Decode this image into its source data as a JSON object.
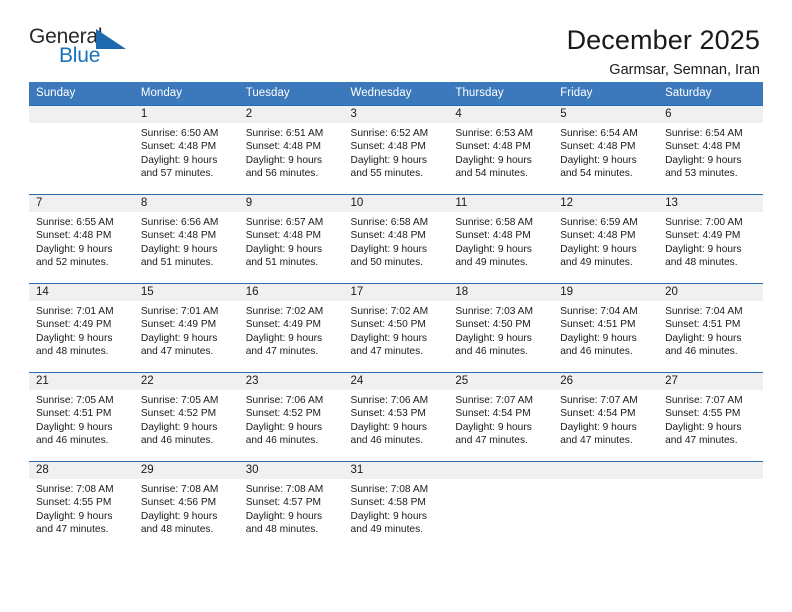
{
  "brand": {
    "name_top": "General",
    "name_bottom": "Blue",
    "color_blue": "#1a72ba",
    "color_dark": "#26292b",
    "triangle_icon": "blue-triangle-icon"
  },
  "header": {
    "title": "December 2025",
    "location": "Garmsar, Semnan, Iran"
  },
  "theme": {
    "header_bg": "#3c78bc",
    "header_text": "#ffffff",
    "daynum_band_bg": "#f0f0f0",
    "row_border": "#2c6ab0"
  },
  "weekdays": [
    "Sunday",
    "Monday",
    "Tuesday",
    "Wednesday",
    "Thursday",
    "Friday",
    "Saturday"
  ],
  "weeks": [
    [
      {
        "day": "",
        "sunrise": "",
        "sunset": "",
        "daylight_line1": "",
        "daylight_line2": "",
        "empty": true
      },
      {
        "day": "1",
        "sunrise": "Sunrise: 6:50 AM",
        "sunset": "Sunset: 4:48 PM",
        "daylight_line1": "Daylight: 9 hours",
        "daylight_line2": "and 57 minutes.",
        "empty": false
      },
      {
        "day": "2",
        "sunrise": "Sunrise: 6:51 AM",
        "sunset": "Sunset: 4:48 PM",
        "daylight_line1": "Daylight: 9 hours",
        "daylight_line2": "and 56 minutes.",
        "empty": false
      },
      {
        "day": "3",
        "sunrise": "Sunrise: 6:52 AM",
        "sunset": "Sunset: 4:48 PM",
        "daylight_line1": "Daylight: 9 hours",
        "daylight_line2": "and 55 minutes.",
        "empty": false
      },
      {
        "day": "4",
        "sunrise": "Sunrise: 6:53 AM",
        "sunset": "Sunset: 4:48 PM",
        "daylight_line1": "Daylight: 9 hours",
        "daylight_line2": "and 54 minutes.",
        "empty": false
      },
      {
        "day": "5",
        "sunrise": "Sunrise: 6:54 AM",
        "sunset": "Sunset: 4:48 PM",
        "daylight_line1": "Daylight: 9 hours",
        "daylight_line2": "and 54 minutes.",
        "empty": false
      },
      {
        "day": "6",
        "sunrise": "Sunrise: 6:54 AM",
        "sunset": "Sunset: 4:48 PM",
        "daylight_line1": "Daylight: 9 hours",
        "daylight_line2": "and 53 minutes.",
        "empty": false
      }
    ],
    [
      {
        "day": "7",
        "sunrise": "Sunrise: 6:55 AM",
        "sunset": "Sunset: 4:48 PM",
        "daylight_line1": "Daylight: 9 hours",
        "daylight_line2": "and 52 minutes.",
        "empty": false
      },
      {
        "day": "8",
        "sunrise": "Sunrise: 6:56 AM",
        "sunset": "Sunset: 4:48 PM",
        "daylight_line1": "Daylight: 9 hours",
        "daylight_line2": "and 51 minutes.",
        "empty": false
      },
      {
        "day": "9",
        "sunrise": "Sunrise: 6:57 AM",
        "sunset": "Sunset: 4:48 PM",
        "daylight_line1": "Daylight: 9 hours",
        "daylight_line2": "and 51 minutes.",
        "empty": false
      },
      {
        "day": "10",
        "sunrise": "Sunrise: 6:58 AM",
        "sunset": "Sunset: 4:48 PM",
        "daylight_line1": "Daylight: 9 hours",
        "daylight_line2": "and 50 minutes.",
        "empty": false
      },
      {
        "day": "11",
        "sunrise": "Sunrise: 6:58 AM",
        "sunset": "Sunset: 4:48 PM",
        "daylight_line1": "Daylight: 9 hours",
        "daylight_line2": "and 49 minutes.",
        "empty": false
      },
      {
        "day": "12",
        "sunrise": "Sunrise: 6:59 AM",
        "sunset": "Sunset: 4:48 PM",
        "daylight_line1": "Daylight: 9 hours",
        "daylight_line2": "and 49 minutes.",
        "empty": false
      },
      {
        "day": "13",
        "sunrise": "Sunrise: 7:00 AM",
        "sunset": "Sunset: 4:49 PM",
        "daylight_line1": "Daylight: 9 hours",
        "daylight_line2": "and 48 minutes.",
        "empty": false
      }
    ],
    [
      {
        "day": "14",
        "sunrise": "Sunrise: 7:01 AM",
        "sunset": "Sunset: 4:49 PM",
        "daylight_line1": "Daylight: 9 hours",
        "daylight_line2": "and 48 minutes.",
        "empty": false
      },
      {
        "day": "15",
        "sunrise": "Sunrise: 7:01 AM",
        "sunset": "Sunset: 4:49 PM",
        "daylight_line1": "Daylight: 9 hours",
        "daylight_line2": "and 47 minutes.",
        "empty": false
      },
      {
        "day": "16",
        "sunrise": "Sunrise: 7:02 AM",
        "sunset": "Sunset: 4:49 PM",
        "daylight_line1": "Daylight: 9 hours",
        "daylight_line2": "and 47 minutes.",
        "empty": false
      },
      {
        "day": "17",
        "sunrise": "Sunrise: 7:02 AM",
        "sunset": "Sunset: 4:50 PM",
        "daylight_line1": "Daylight: 9 hours",
        "daylight_line2": "and 47 minutes.",
        "empty": false
      },
      {
        "day": "18",
        "sunrise": "Sunrise: 7:03 AM",
        "sunset": "Sunset: 4:50 PM",
        "daylight_line1": "Daylight: 9 hours",
        "daylight_line2": "and 46 minutes.",
        "empty": false
      },
      {
        "day": "19",
        "sunrise": "Sunrise: 7:04 AM",
        "sunset": "Sunset: 4:51 PM",
        "daylight_line1": "Daylight: 9 hours",
        "daylight_line2": "and 46 minutes.",
        "empty": false
      },
      {
        "day": "20",
        "sunrise": "Sunrise: 7:04 AM",
        "sunset": "Sunset: 4:51 PM",
        "daylight_line1": "Daylight: 9 hours",
        "daylight_line2": "and 46 minutes.",
        "empty": false
      }
    ],
    [
      {
        "day": "21",
        "sunrise": "Sunrise: 7:05 AM",
        "sunset": "Sunset: 4:51 PM",
        "daylight_line1": "Daylight: 9 hours",
        "daylight_line2": "and 46 minutes.",
        "empty": false
      },
      {
        "day": "22",
        "sunrise": "Sunrise: 7:05 AM",
        "sunset": "Sunset: 4:52 PM",
        "daylight_line1": "Daylight: 9 hours",
        "daylight_line2": "and 46 minutes.",
        "empty": false
      },
      {
        "day": "23",
        "sunrise": "Sunrise: 7:06 AM",
        "sunset": "Sunset: 4:52 PM",
        "daylight_line1": "Daylight: 9 hours",
        "daylight_line2": "and 46 minutes.",
        "empty": false
      },
      {
        "day": "24",
        "sunrise": "Sunrise: 7:06 AM",
        "sunset": "Sunset: 4:53 PM",
        "daylight_line1": "Daylight: 9 hours",
        "daylight_line2": "and 46 minutes.",
        "empty": false
      },
      {
        "day": "25",
        "sunrise": "Sunrise: 7:07 AM",
        "sunset": "Sunset: 4:54 PM",
        "daylight_line1": "Daylight: 9 hours",
        "daylight_line2": "and 47 minutes.",
        "empty": false
      },
      {
        "day": "26",
        "sunrise": "Sunrise: 7:07 AM",
        "sunset": "Sunset: 4:54 PM",
        "daylight_line1": "Daylight: 9 hours",
        "daylight_line2": "and 47 minutes.",
        "empty": false
      },
      {
        "day": "27",
        "sunrise": "Sunrise: 7:07 AM",
        "sunset": "Sunset: 4:55 PM",
        "daylight_line1": "Daylight: 9 hours",
        "daylight_line2": "and 47 minutes.",
        "empty": false
      }
    ],
    [
      {
        "day": "28",
        "sunrise": "Sunrise: 7:08 AM",
        "sunset": "Sunset: 4:55 PM",
        "daylight_line1": "Daylight: 9 hours",
        "daylight_line2": "and 47 minutes.",
        "empty": false
      },
      {
        "day": "29",
        "sunrise": "Sunrise: 7:08 AM",
        "sunset": "Sunset: 4:56 PM",
        "daylight_line1": "Daylight: 9 hours",
        "daylight_line2": "and 48 minutes.",
        "empty": false
      },
      {
        "day": "30",
        "sunrise": "Sunrise: 7:08 AM",
        "sunset": "Sunset: 4:57 PM",
        "daylight_line1": "Daylight: 9 hours",
        "daylight_line2": "and 48 minutes.",
        "empty": false
      },
      {
        "day": "31",
        "sunrise": "Sunrise: 7:08 AM",
        "sunset": "Sunset: 4:58 PM",
        "daylight_line1": "Daylight: 9 hours",
        "daylight_line2": "and 49 minutes.",
        "empty": false
      },
      {
        "day": "",
        "sunrise": "",
        "sunset": "",
        "daylight_line1": "",
        "daylight_line2": "",
        "empty": true
      },
      {
        "day": "",
        "sunrise": "",
        "sunset": "",
        "daylight_line1": "",
        "daylight_line2": "",
        "empty": true
      },
      {
        "day": "",
        "sunrise": "",
        "sunset": "",
        "daylight_line1": "",
        "daylight_line2": "",
        "empty": true
      }
    ]
  ]
}
